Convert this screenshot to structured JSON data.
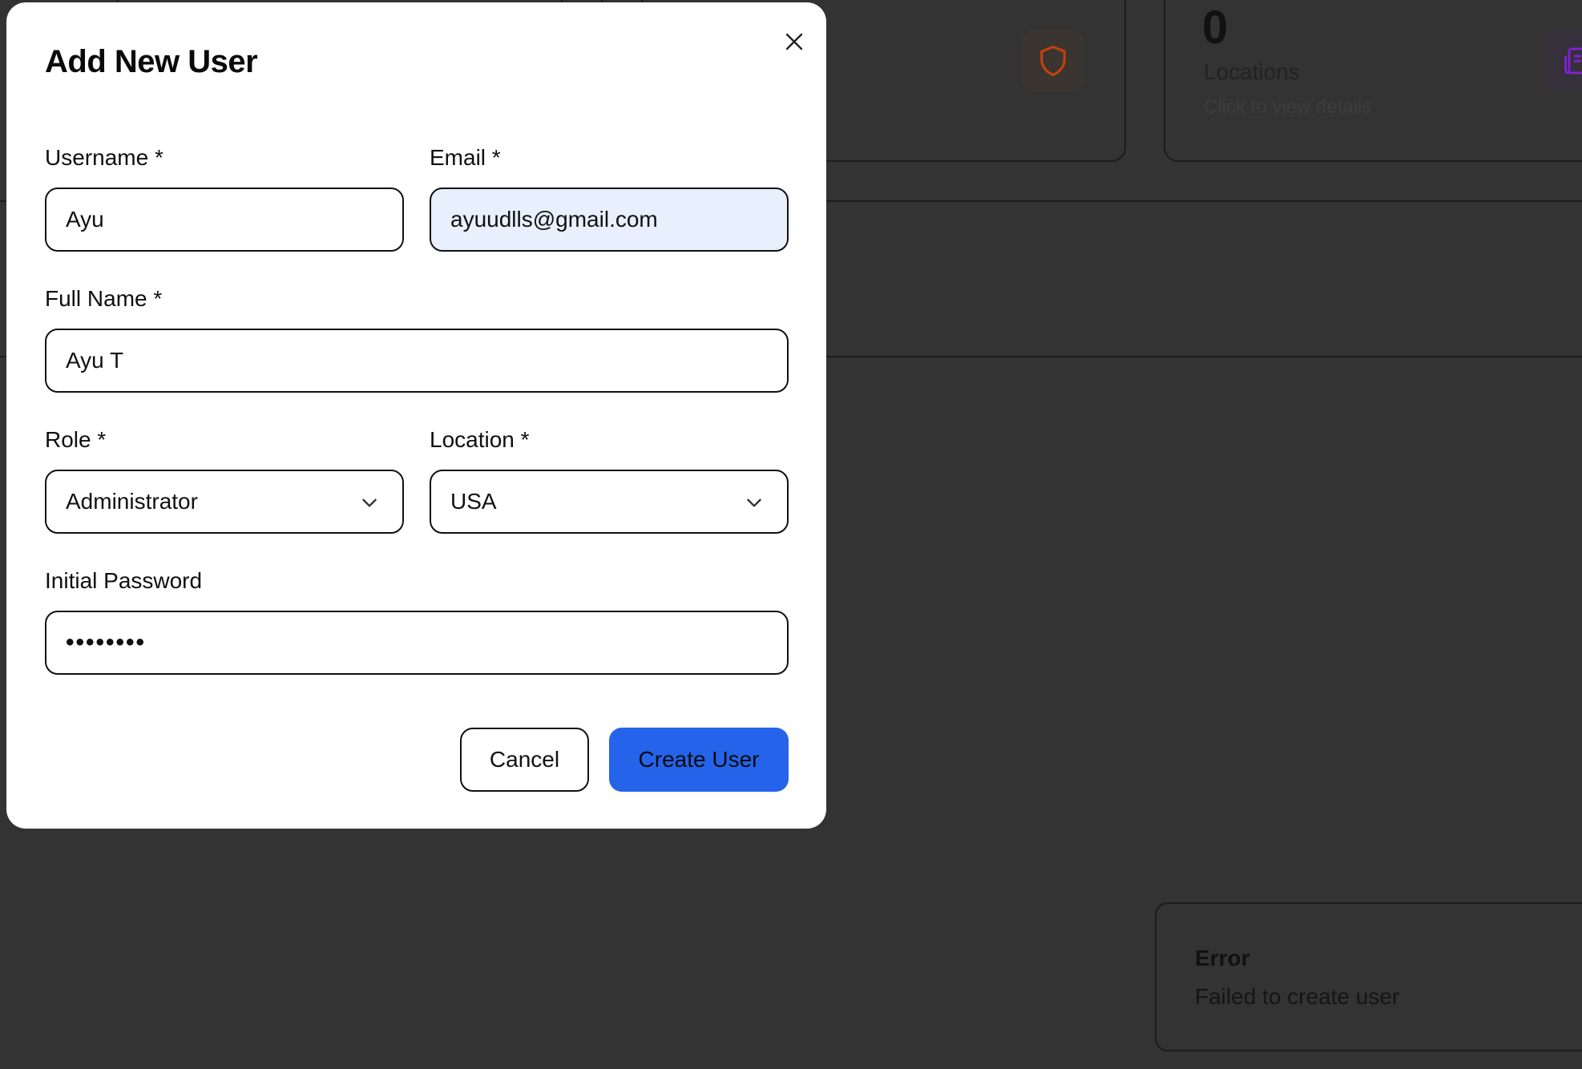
{
  "background": {
    "stat_card": {
      "value": "0",
      "label": "Locations",
      "hint": "Click to view details"
    },
    "toast": {
      "title": "Error",
      "message": "Failed to create user"
    },
    "icons": [
      "shield-icon",
      "document-icon"
    ]
  },
  "modal": {
    "title": "Add New User",
    "close_icon": "close-icon",
    "fields": {
      "username": {
        "label": "Username *",
        "value": "Ayu"
      },
      "email": {
        "label": "Email *",
        "value": "ayuudlls@gmail.com"
      },
      "full_name": {
        "label": "Full Name *",
        "value": "Ayu T"
      },
      "role": {
        "label": "Role *",
        "value": "Administrator"
      },
      "location": {
        "label": "Location *",
        "value": "USA"
      },
      "password": {
        "label": "Initial Password",
        "value": "••••••••"
      }
    },
    "buttons": {
      "cancel": "Cancel",
      "create": "Create User"
    }
  },
  "colors": {
    "overlay": "#333333",
    "primary": "#2563eb",
    "autofill": "#e8f0fe",
    "shield_accent": "#c2410c",
    "document_accent": "#7e22ce"
  }
}
